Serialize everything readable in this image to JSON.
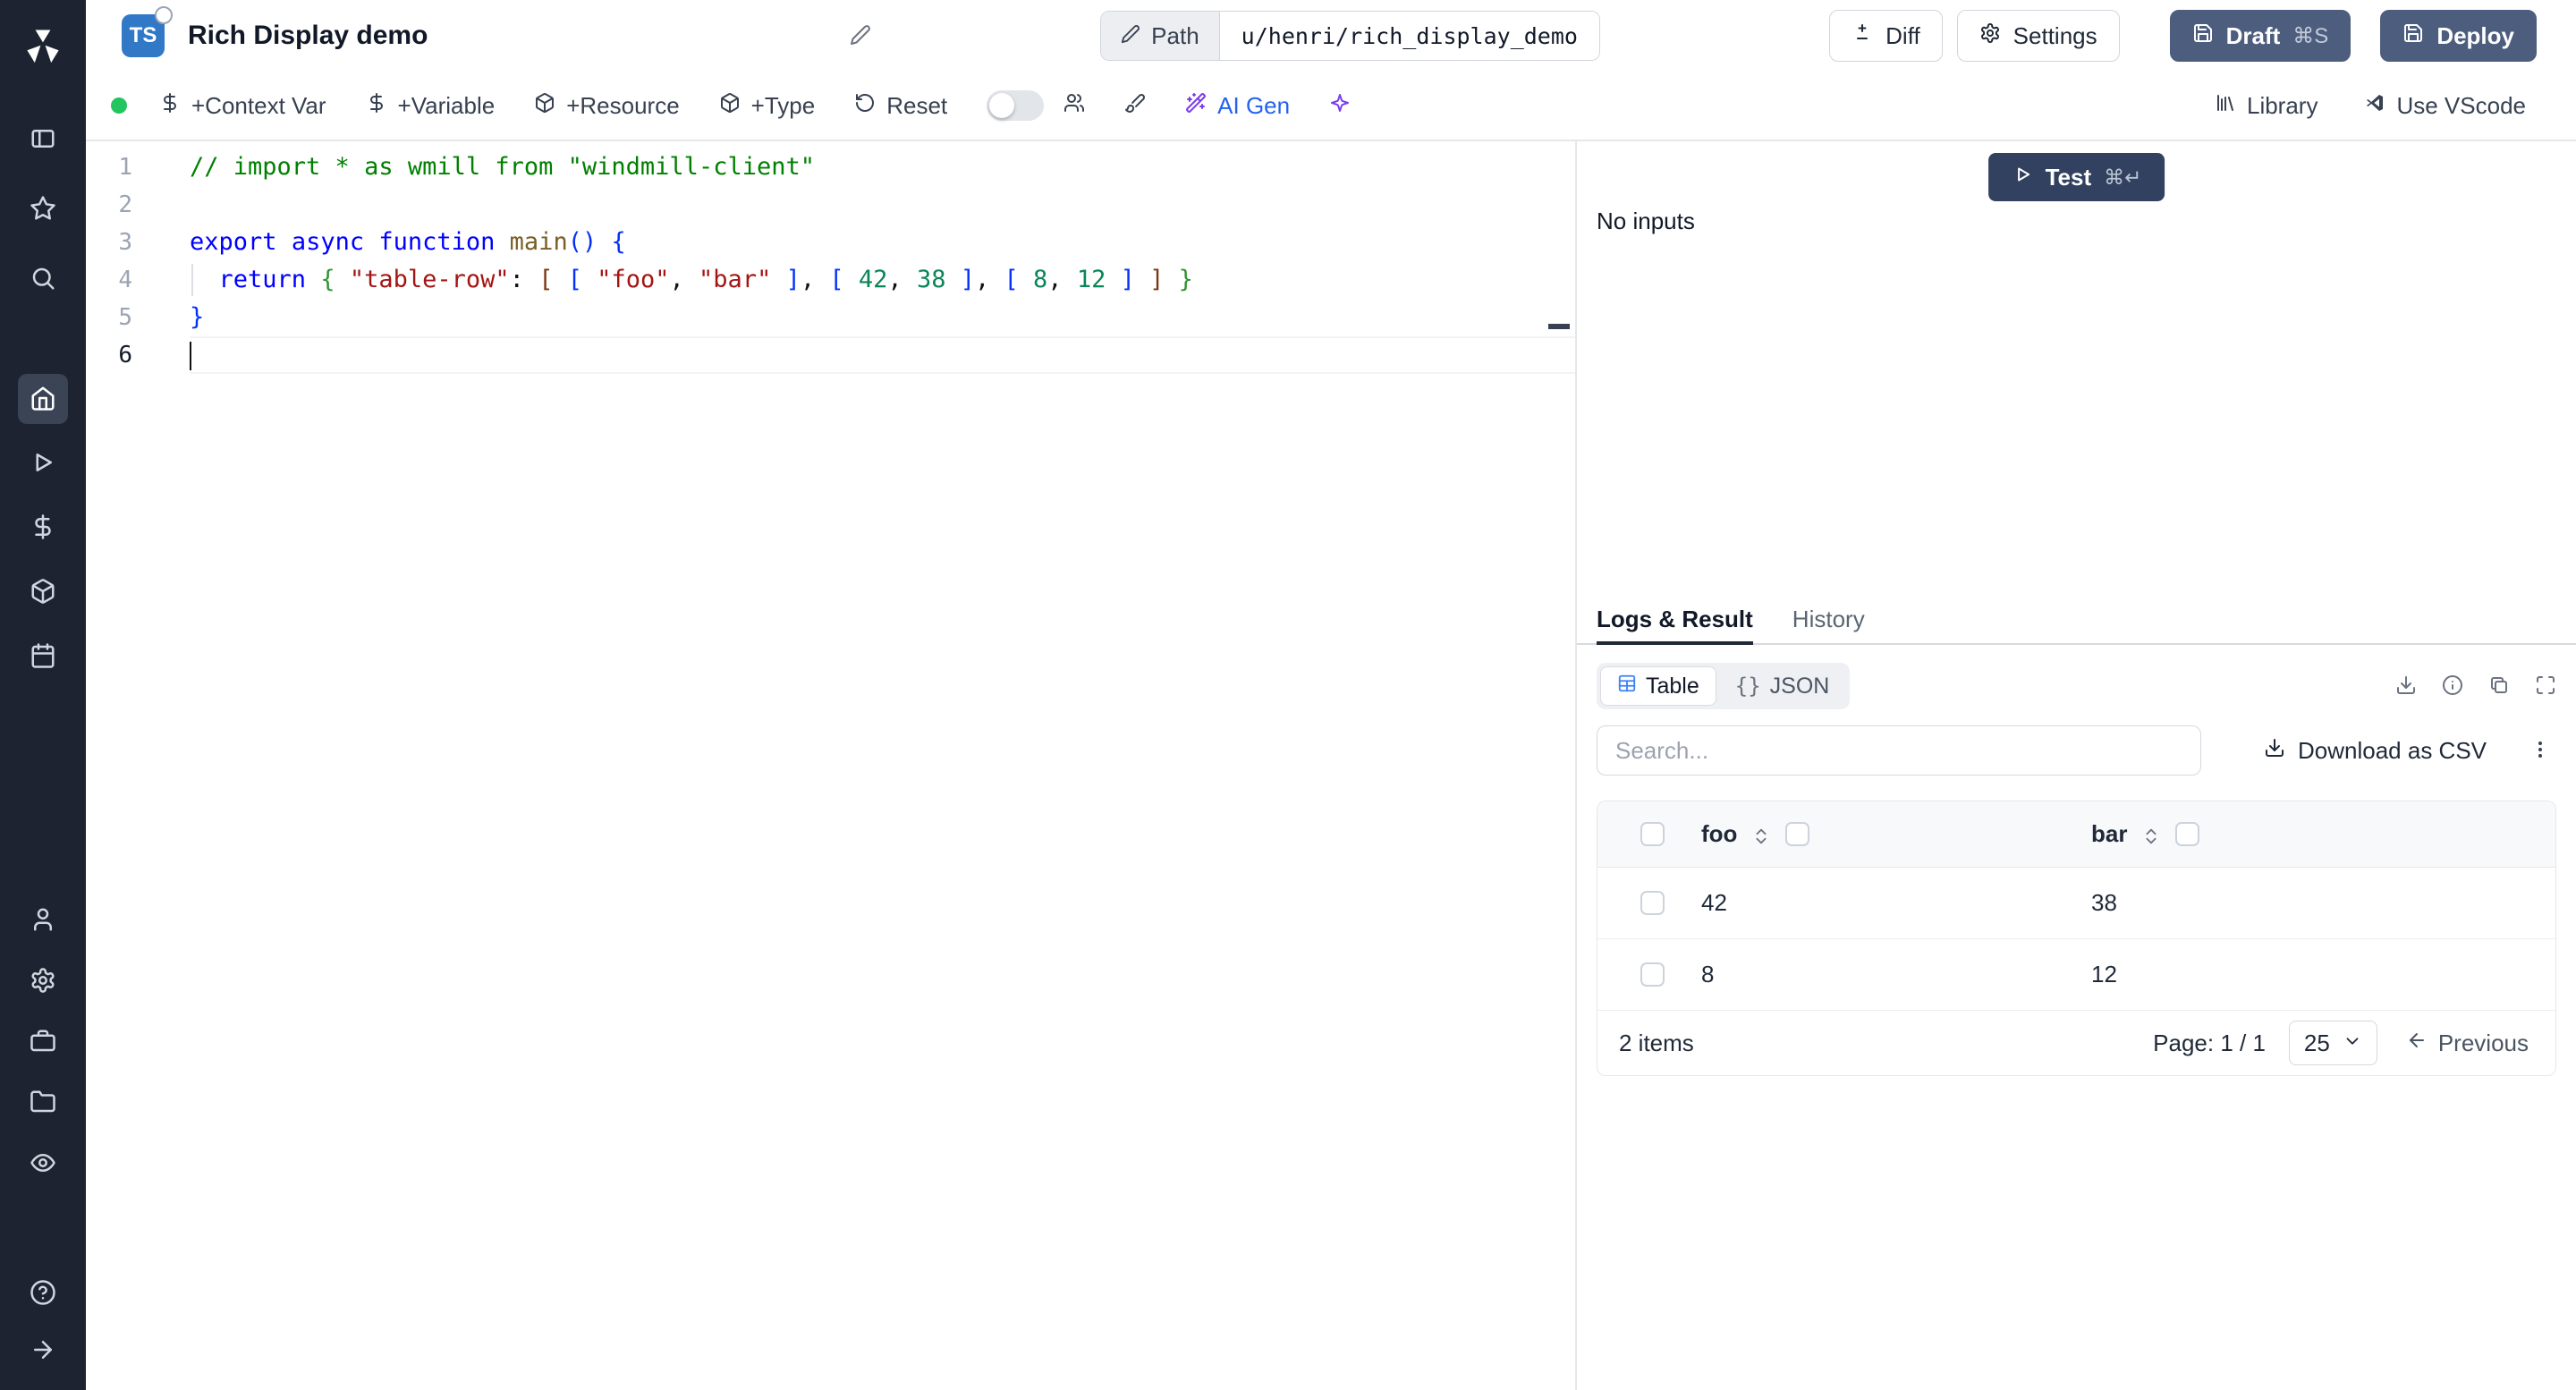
{
  "colors": {
    "sidebar_bg": "#1d2330",
    "ts_badge": "#3178c6",
    "dark_button": "#4d5d7d",
    "test_button": "#32415f",
    "status_green": "#22c55e",
    "ai_blue": "#2563eb",
    "ai_purple": "#7c3aed",
    "table_icon_blue": "#3b82f6"
  },
  "header": {
    "lang_badge": "TS",
    "title": "Rich Display demo",
    "path_label": "Path",
    "path_value": "u/henri/rich_display_demo",
    "diff_label": "Diff",
    "settings_label": "Settings",
    "draft_label": "Draft",
    "draft_shortcut": "⌘S",
    "deploy_label": "Deploy"
  },
  "toolbar": {
    "context_var_label": "+Context Var",
    "variable_label": "+Variable",
    "resource_label": "+Resource",
    "type_label": "+Type",
    "reset_label": "Reset",
    "ai_gen_label": "AI Gen",
    "library_label": "Library",
    "vscode_label": "Use VScode"
  },
  "editor": {
    "lines": [
      {
        "num": "1",
        "tokens": [
          {
            "t": "// import * as wmill from \"windmill-client\"",
            "c": "comment"
          }
        ]
      },
      {
        "num": "2",
        "tokens": []
      },
      {
        "num": "3",
        "tokens": [
          {
            "t": "export",
            "c": "kw"
          },
          {
            "t": " "
          },
          {
            "t": "async",
            "c": "kw"
          },
          {
            "t": " "
          },
          {
            "t": "function",
            "c": "kw"
          },
          {
            "t": " "
          },
          {
            "t": "main",
            "c": "fn"
          },
          {
            "t": "(",
            "c": "b1"
          },
          {
            "t": ")",
            "c": "b1"
          },
          {
            "t": " "
          },
          {
            "t": "{",
            "c": "b1"
          }
        ]
      },
      {
        "num": "4",
        "tokens": [
          {
            "t": "  "
          },
          {
            "t": "return",
            "c": "kw"
          },
          {
            "t": " "
          },
          {
            "t": "{",
            "c": "b2"
          },
          {
            "t": " "
          },
          {
            "t": "\"table-row\"",
            "c": "str"
          },
          {
            "t": ": "
          },
          {
            "t": "[",
            "c": "b3"
          },
          {
            "t": " "
          },
          {
            "t": "[",
            "c": "b1"
          },
          {
            "t": " "
          },
          {
            "t": "\"foo\"",
            "c": "str"
          },
          {
            "t": ", "
          },
          {
            "t": "\"bar\"",
            "c": "str"
          },
          {
            "t": " "
          },
          {
            "t": "]",
            "c": "b1"
          },
          {
            "t": ", "
          },
          {
            "t": "[",
            "c": "b1"
          },
          {
            "t": " "
          },
          {
            "t": "42",
            "c": "num"
          },
          {
            "t": ", "
          },
          {
            "t": "38",
            "c": "num"
          },
          {
            "t": " "
          },
          {
            "t": "]",
            "c": "b1"
          },
          {
            "t": ", "
          },
          {
            "t": "[",
            "c": "b1"
          },
          {
            "t": " "
          },
          {
            "t": "8",
            "c": "num"
          },
          {
            "t": ", "
          },
          {
            "t": "12",
            "c": "num"
          },
          {
            "t": " "
          },
          {
            "t": "]",
            "c": "b1"
          },
          {
            "t": " "
          },
          {
            "t": "]",
            "c": "b3"
          },
          {
            "t": " "
          },
          {
            "t": "}",
            "c": "b2"
          }
        ]
      },
      {
        "num": "5",
        "tokens": [
          {
            "t": "}",
            "c": "b1"
          }
        ]
      },
      {
        "num": "6",
        "tokens": [],
        "cursor": true,
        "active": true
      }
    ]
  },
  "run": {
    "test_label": "Test",
    "test_shortcut": "⌘↵",
    "no_inputs": "No inputs"
  },
  "result_panel": {
    "tabs": [
      {
        "label": "Logs & Result"
      },
      {
        "label": "History"
      }
    ],
    "view_table_label": "Table",
    "view_json_label": "JSON",
    "json_glyph": "{}",
    "search_placeholder": "Search...",
    "download_csv_label": "Download as CSV",
    "table": {
      "columns": [
        "foo",
        "bar"
      ],
      "rows": [
        [
          "42",
          "38"
        ],
        [
          "8",
          "12"
        ]
      ],
      "items_label": "2 items",
      "page_label": "Page: 1 / 1",
      "page_size": "25",
      "previous_label": "Previous"
    }
  }
}
